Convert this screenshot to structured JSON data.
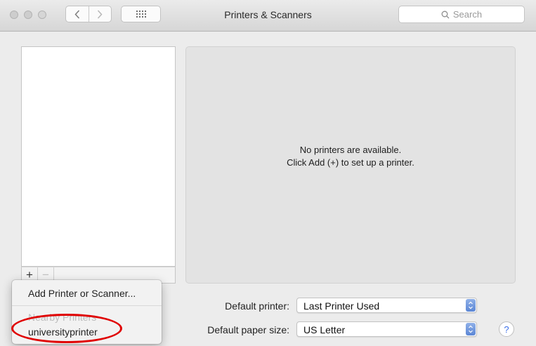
{
  "window": {
    "title": "Printers & Scanners"
  },
  "toolbar": {
    "search_placeholder": "Search"
  },
  "list": {
    "add_label": "+",
    "remove_label": "−"
  },
  "detail": {
    "empty_line1": "No printers are available.",
    "empty_line2": "Click Add (+) to set up a printer."
  },
  "menu": {
    "add_item": "Add Printer or Scanner...",
    "section_header": "Nearby Printers",
    "items": [
      {
        "label": "universityprinter"
      }
    ]
  },
  "settings": {
    "default_printer_label": "Default printer:",
    "default_printer_value": "Last Printer Used",
    "paper_size_label": "Default paper size:",
    "paper_size_value": "US Letter"
  },
  "help": {
    "label": "?"
  },
  "colors": {
    "highlight_ring": "#e00000",
    "accent": "#5c87d6"
  },
  "icons": [
    "close-icon",
    "minimize-icon",
    "zoom-icon",
    "back-icon",
    "forward-icon",
    "grid-icon",
    "search-icon",
    "popup-arrows-icon"
  ]
}
